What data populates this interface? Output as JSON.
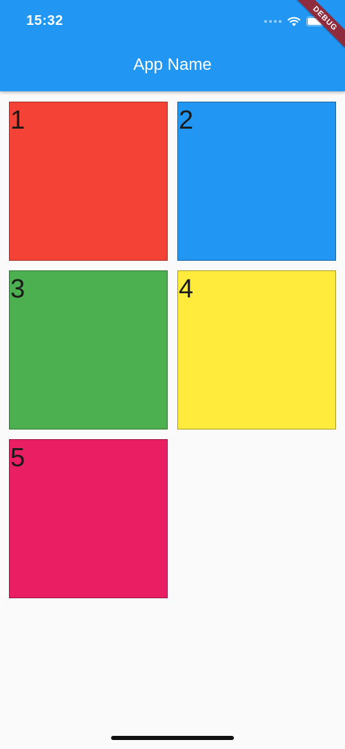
{
  "status_bar": {
    "time": "15:32",
    "icons": [
      "cellular-signal-icon",
      "wifi-icon",
      "battery-icon"
    ]
  },
  "app_bar": {
    "title": "App Name",
    "color": "#2196f3"
  },
  "debug_banner": {
    "label": "DEBUG",
    "color": "#8e2b3c"
  },
  "grid": {
    "tiles": [
      {
        "label": "1",
        "color": "#f44336"
      },
      {
        "label": "2",
        "color": "#2196f3"
      },
      {
        "label": "3",
        "color": "#4caf50"
      },
      {
        "label": "4",
        "color": "#ffeb3b"
      },
      {
        "label": "5",
        "color": "#e91e63"
      }
    ]
  },
  "background": "#fafafa"
}
